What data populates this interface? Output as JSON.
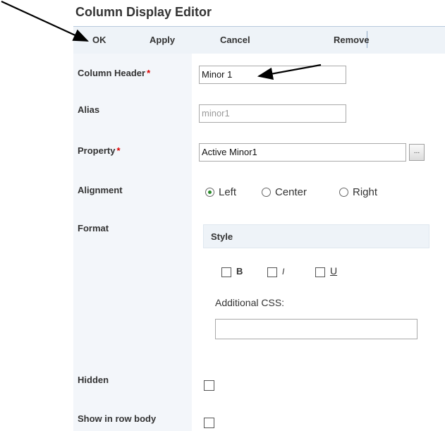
{
  "title": "Column Display Editor",
  "toolbar": {
    "ok": "OK",
    "apply": "Apply",
    "cancel": "Cancel",
    "remove": "Remove"
  },
  "fields": {
    "column_header": {
      "label": "Column Header",
      "required": "*",
      "value": "Minor 1"
    },
    "alias": {
      "label": "Alias",
      "placeholder": "minor1"
    },
    "property": {
      "label": "Property",
      "required": "*",
      "value": "Active Minor1",
      "browse": "..."
    },
    "alignment": {
      "label": "Alignment",
      "options": [
        "Left",
        "Center",
        "Right"
      ],
      "selected": "Left"
    },
    "format": {
      "label": "Format",
      "style_header": "Style",
      "bold": "B",
      "italic": "I",
      "underline": "U",
      "additional_css_label": "Additional CSS:",
      "additional_css_value": ""
    },
    "hidden": {
      "label": "Hidden",
      "checked": false
    },
    "show_in_row_body": {
      "label": "Show in row body",
      "checked": false
    }
  },
  "colors": {
    "toolbar_bg": "#eef3f8",
    "label_column_bg": "#f3f6fa",
    "required": "#dd0000",
    "radio_selected": "#2a8a2a"
  },
  "annotations": [
    "arrow-to-ok-button",
    "arrow-to-column-header-input"
  ]
}
